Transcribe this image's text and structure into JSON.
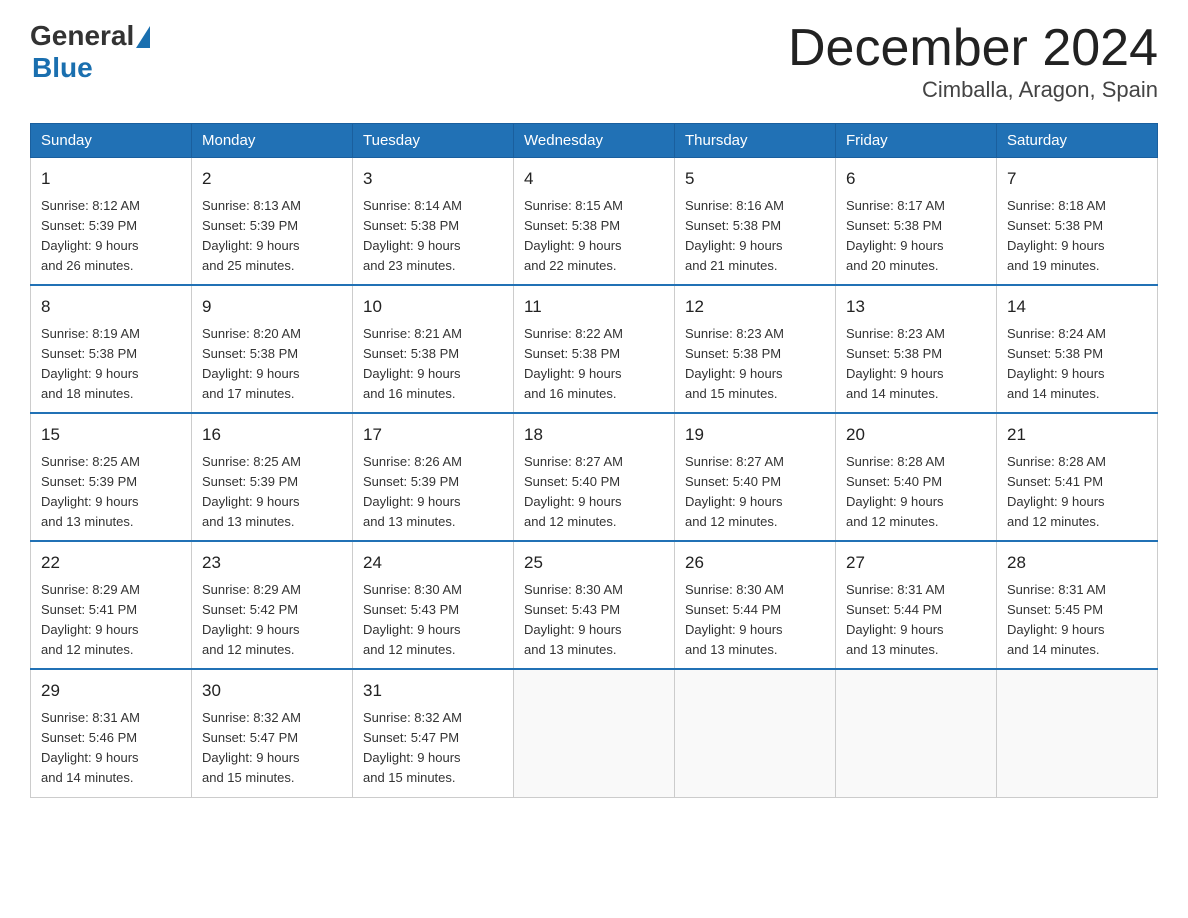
{
  "header": {
    "logo_general": "General",
    "logo_blue": "Blue",
    "month_title": "December 2024",
    "location": "Cimballa, Aragon, Spain"
  },
  "weekdays": [
    "Sunday",
    "Monday",
    "Tuesday",
    "Wednesday",
    "Thursday",
    "Friday",
    "Saturday"
  ],
  "weeks": [
    [
      {
        "day": "1",
        "sunrise": "8:12 AM",
        "sunset": "5:39 PM",
        "daylight": "9 hours and 26 minutes."
      },
      {
        "day": "2",
        "sunrise": "8:13 AM",
        "sunset": "5:39 PM",
        "daylight": "9 hours and 25 minutes."
      },
      {
        "day": "3",
        "sunrise": "8:14 AM",
        "sunset": "5:38 PM",
        "daylight": "9 hours and 23 minutes."
      },
      {
        "day": "4",
        "sunrise": "8:15 AM",
        "sunset": "5:38 PM",
        "daylight": "9 hours and 22 minutes."
      },
      {
        "day": "5",
        "sunrise": "8:16 AM",
        "sunset": "5:38 PM",
        "daylight": "9 hours and 21 minutes."
      },
      {
        "day": "6",
        "sunrise": "8:17 AM",
        "sunset": "5:38 PM",
        "daylight": "9 hours and 20 minutes."
      },
      {
        "day": "7",
        "sunrise": "8:18 AM",
        "sunset": "5:38 PM",
        "daylight": "9 hours and 19 minutes."
      }
    ],
    [
      {
        "day": "8",
        "sunrise": "8:19 AM",
        "sunset": "5:38 PM",
        "daylight": "9 hours and 18 minutes."
      },
      {
        "day": "9",
        "sunrise": "8:20 AM",
        "sunset": "5:38 PM",
        "daylight": "9 hours and 17 minutes."
      },
      {
        "day": "10",
        "sunrise": "8:21 AM",
        "sunset": "5:38 PM",
        "daylight": "9 hours and 16 minutes."
      },
      {
        "day": "11",
        "sunrise": "8:22 AM",
        "sunset": "5:38 PM",
        "daylight": "9 hours and 16 minutes."
      },
      {
        "day": "12",
        "sunrise": "8:23 AM",
        "sunset": "5:38 PM",
        "daylight": "9 hours and 15 minutes."
      },
      {
        "day": "13",
        "sunrise": "8:23 AM",
        "sunset": "5:38 PM",
        "daylight": "9 hours and 14 minutes."
      },
      {
        "day": "14",
        "sunrise": "8:24 AM",
        "sunset": "5:38 PM",
        "daylight": "9 hours and 14 minutes."
      }
    ],
    [
      {
        "day": "15",
        "sunrise": "8:25 AM",
        "sunset": "5:39 PM",
        "daylight": "9 hours and 13 minutes."
      },
      {
        "day": "16",
        "sunrise": "8:25 AM",
        "sunset": "5:39 PM",
        "daylight": "9 hours and 13 minutes."
      },
      {
        "day": "17",
        "sunrise": "8:26 AM",
        "sunset": "5:39 PM",
        "daylight": "9 hours and 13 minutes."
      },
      {
        "day": "18",
        "sunrise": "8:27 AM",
        "sunset": "5:40 PM",
        "daylight": "9 hours and 12 minutes."
      },
      {
        "day": "19",
        "sunrise": "8:27 AM",
        "sunset": "5:40 PM",
        "daylight": "9 hours and 12 minutes."
      },
      {
        "day": "20",
        "sunrise": "8:28 AM",
        "sunset": "5:40 PM",
        "daylight": "9 hours and 12 minutes."
      },
      {
        "day": "21",
        "sunrise": "8:28 AM",
        "sunset": "5:41 PM",
        "daylight": "9 hours and 12 minutes."
      }
    ],
    [
      {
        "day": "22",
        "sunrise": "8:29 AM",
        "sunset": "5:41 PM",
        "daylight": "9 hours and 12 minutes."
      },
      {
        "day": "23",
        "sunrise": "8:29 AM",
        "sunset": "5:42 PM",
        "daylight": "9 hours and 12 minutes."
      },
      {
        "day": "24",
        "sunrise": "8:30 AM",
        "sunset": "5:43 PM",
        "daylight": "9 hours and 12 minutes."
      },
      {
        "day": "25",
        "sunrise": "8:30 AM",
        "sunset": "5:43 PM",
        "daylight": "9 hours and 13 minutes."
      },
      {
        "day": "26",
        "sunrise": "8:30 AM",
        "sunset": "5:44 PM",
        "daylight": "9 hours and 13 minutes."
      },
      {
        "day": "27",
        "sunrise": "8:31 AM",
        "sunset": "5:44 PM",
        "daylight": "9 hours and 13 minutes."
      },
      {
        "day": "28",
        "sunrise": "8:31 AM",
        "sunset": "5:45 PM",
        "daylight": "9 hours and 14 minutes."
      }
    ],
    [
      {
        "day": "29",
        "sunrise": "8:31 AM",
        "sunset": "5:46 PM",
        "daylight": "9 hours and 14 minutes."
      },
      {
        "day": "30",
        "sunrise": "8:32 AM",
        "sunset": "5:47 PM",
        "daylight": "9 hours and 15 minutes."
      },
      {
        "day": "31",
        "sunrise": "8:32 AM",
        "sunset": "5:47 PM",
        "daylight": "9 hours and 15 minutes."
      },
      null,
      null,
      null,
      null
    ]
  ],
  "labels": {
    "sunrise": "Sunrise:",
    "sunset": "Sunset:",
    "daylight": "Daylight:"
  }
}
